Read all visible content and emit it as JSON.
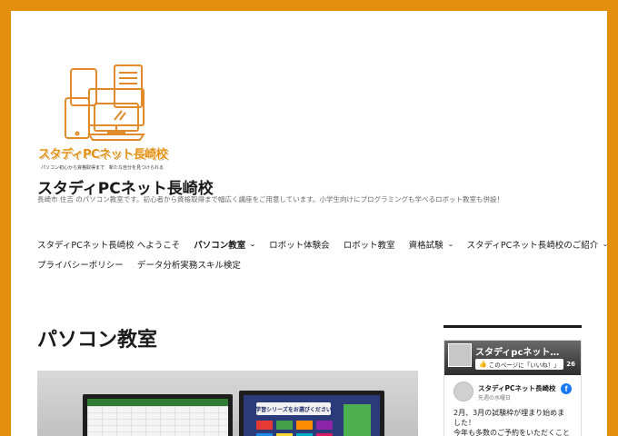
{
  "header": {
    "logo_title": "スタディPCネット長崎校",
    "logo_tagline": "パソコン初心から資格取得まで　新たな自分を見つけられる",
    "site_title": "スタディPCネット長崎校",
    "site_description": "長崎市 住吉 のパソコン教室です。初心者から資格取得まで幅広く講座をご用意しています。小学生向けにプログラミングも学べるロボット教室も併設！"
  },
  "nav": {
    "row1": [
      {
        "label": "スタディPCネット長崎校 へようこそ",
        "current": false,
        "has_submenu": false
      },
      {
        "label": "パソコン教室",
        "current": true,
        "has_submenu": true
      },
      {
        "label": "ロボット体験会",
        "current": false,
        "has_submenu": false
      },
      {
        "label": "ロボット教室",
        "current": false,
        "has_submenu": false
      },
      {
        "label": "資格試験",
        "current": false,
        "has_submenu": true
      },
      {
        "label": "スタディPCネット長崎校のご紹介",
        "current": false,
        "has_submenu": true
      }
    ],
    "row2": [
      {
        "label": "プライバシーポリシー",
        "current": false,
        "has_submenu": false
      },
      {
        "label": "データ分析実務スキル検定",
        "current": false,
        "has_submenu": false
      }
    ],
    "caret_glyph": "⌄"
  },
  "main": {
    "page_title": "パソコン教室",
    "hero_banner_text": "学習シリーズをお選びください"
  },
  "sidebar": {
    "facebook": {
      "cover_name": "スタディpcネット…",
      "like_label": "このページに「いいね！」",
      "like_count": "26",
      "post_author": "スタディPCネット長崎校",
      "post_time": "先週の水曜日",
      "post_text_lines": [
        "2月、3月の試験枠が埋まり始めました！",
        "今年も多数のご予約をいただくこと"
      ],
      "fb_glyph": "f"
    }
  },
  "colors": {
    "background_orange": "#e39010",
    "logo_orange": "#e08a2a",
    "text_dark": "#1a1a1a",
    "facebook_blue": "#1877f2"
  }
}
